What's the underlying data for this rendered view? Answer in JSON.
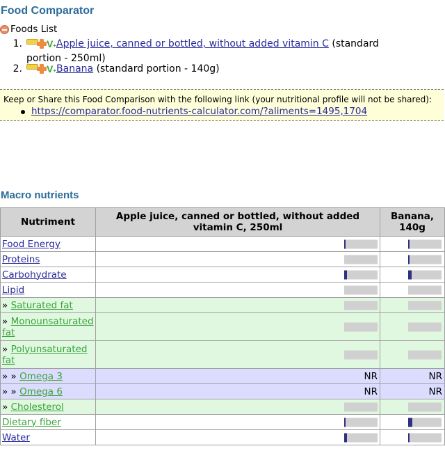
{
  "page_title": "Food Comparator",
  "foods_list": {
    "heading": "Foods List",
    "items": [
      {
        "num": "1.",
        "name": "Apple juice, canned or bottled, without added vitamin C",
        "portion": "(standard portion - 250ml)"
      },
      {
        "num": "2.",
        "name": "Banana",
        "portion": "(standard portion - 140g)"
      }
    ]
  },
  "share": {
    "text": "Keep or Share this Food Comparison with the following link (your nutritional profile will not be shared):",
    "link": "https://comparator.food-nutrients-calculator.com/?aliments=1495,1704"
  },
  "macro": {
    "title": "Macro nutrients",
    "headers": [
      "Nutriment",
      "Apple juice, canned or bottled, without added vitamin C, 250ml",
      "Banana, 140g"
    ],
    "rows": [
      {
        "prefix": "",
        "name": "Food Energy",
        "style": "white",
        "a_fill": 0.05,
        "b_fill": 0.05
      },
      {
        "prefix": "",
        "name": "Proteins",
        "style": "white",
        "a_fill": 0.0,
        "b_fill": 0.02
      },
      {
        "prefix": "",
        "name": "Carbohydrate",
        "style": "white",
        "a_fill": 0.09,
        "b_fill": 0.11
      },
      {
        "prefix": "",
        "name": "Lipid",
        "style": "white",
        "a_fill": 0.0,
        "b_fill": 0.0
      },
      {
        "prefix": "» ",
        "name": "Saturated fat",
        "style": "green",
        "a_fill": 0.0,
        "b_fill": 0.0
      },
      {
        "prefix": "» ",
        "name": "Monounsaturated fat",
        "style": "green",
        "a_fill": 0.0,
        "b_fill": 0.0
      },
      {
        "prefix": "» ",
        "name": "Polyunsaturated fat",
        "style": "green",
        "a_fill": 0.0,
        "b_fill": 0.0
      },
      {
        "prefix": "» » ",
        "name": "Omega 3",
        "style": "blue",
        "a_text": "NR",
        "b_text": "NR"
      },
      {
        "prefix": "» » ",
        "name": "Omega 6",
        "style": "blue",
        "a_text": "NR",
        "b_text": "NR"
      },
      {
        "prefix": "» ",
        "name": "Cholesterol",
        "style": "green",
        "a_fill": 0.0,
        "b_fill": 0.0
      },
      {
        "prefix": "",
        "name": "Dietary fiber",
        "style": "white",
        "a_fill": 0.01,
        "b_fill": 0.12
      },
      {
        "prefix": "",
        "name": "Water",
        "style": "white",
        "a_fill": 0.08,
        "b_fill": 0.03
      }
    ]
  }
}
